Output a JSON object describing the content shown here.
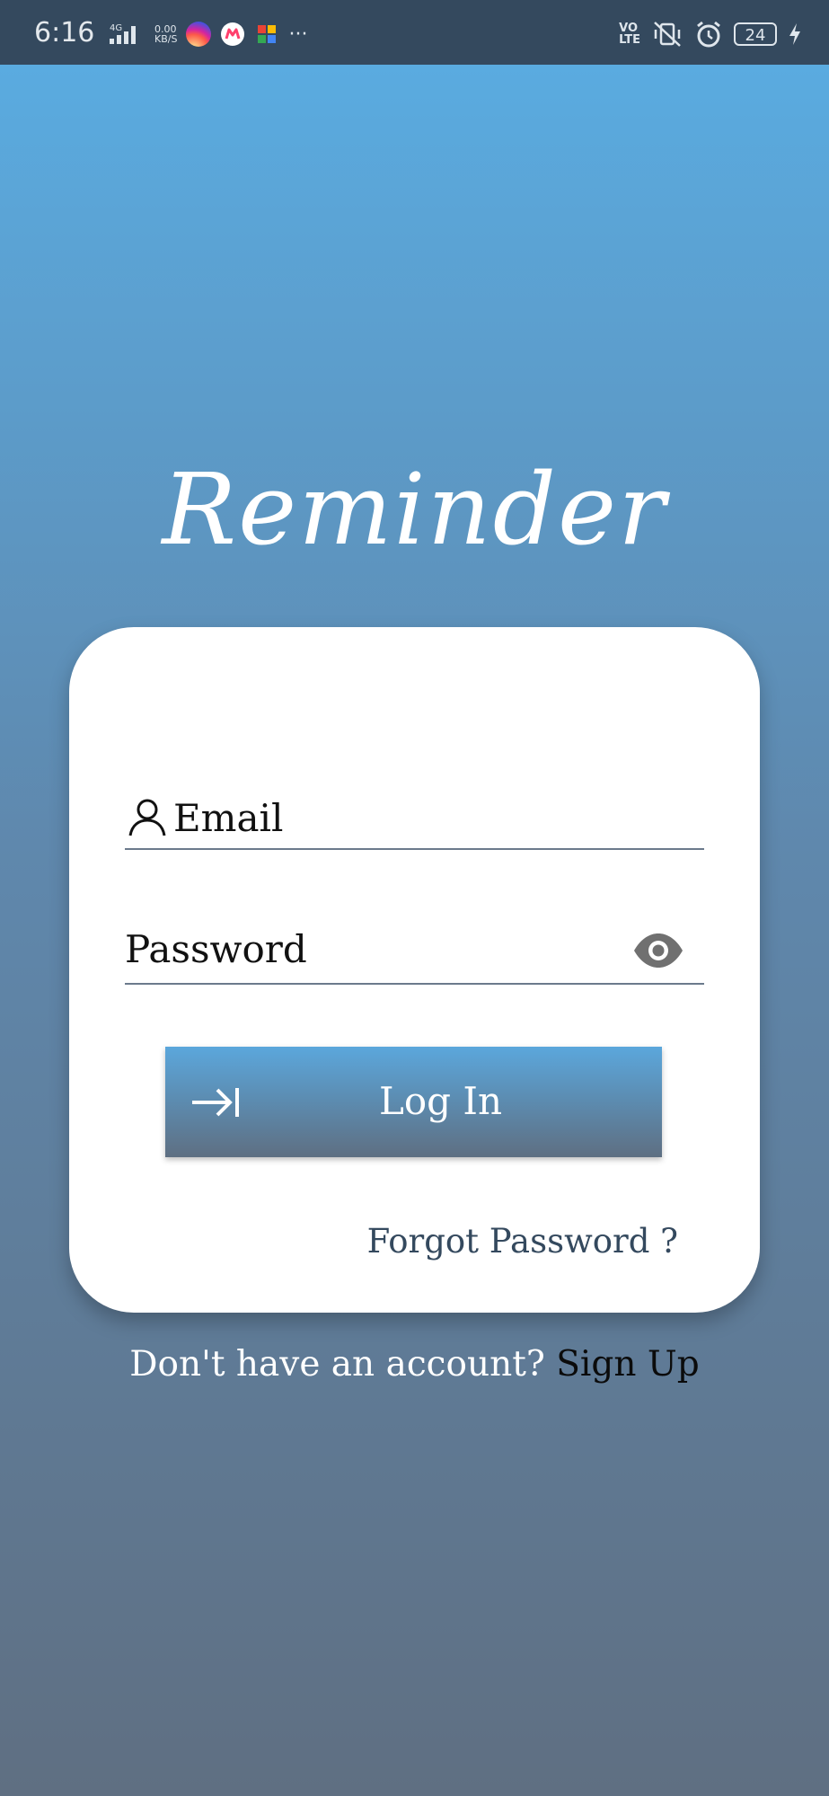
{
  "status_bar": {
    "time": "6:16",
    "network_type": "4G",
    "data_speed_value": "0.00",
    "data_speed_unit": "KB/S",
    "overflow": "···",
    "volte_top": "VO",
    "volte_bottom": "LTE",
    "battery_level": "24",
    "icons": [
      "signal-icon",
      "instagram-icon",
      "myntra-icon",
      "puzzle-app-icon",
      "vibrate-icon",
      "alarm-icon",
      "battery-icon",
      "charging-icon"
    ]
  },
  "app": {
    "logo_text": "Reminder"
  },
  "login_form": {
    "email_placeholder": "Email",
    "password_placeholder": "Password",
    "login_label": "Log In",
    "forgot_password_label": "Forgot Password ?"
  },
  "signup": {
    "prompt": "Don't have an account? ",
    "link_label": "Sign Up"
  },
  "colors": {
    "status_bar": "#34495e",
    "gradient_top": "#5aabe0",
    "gradient_bottom": "#5f6f82",
    "card": "#ffffff",
    "forgot_text": "#34495e"
  }
}
